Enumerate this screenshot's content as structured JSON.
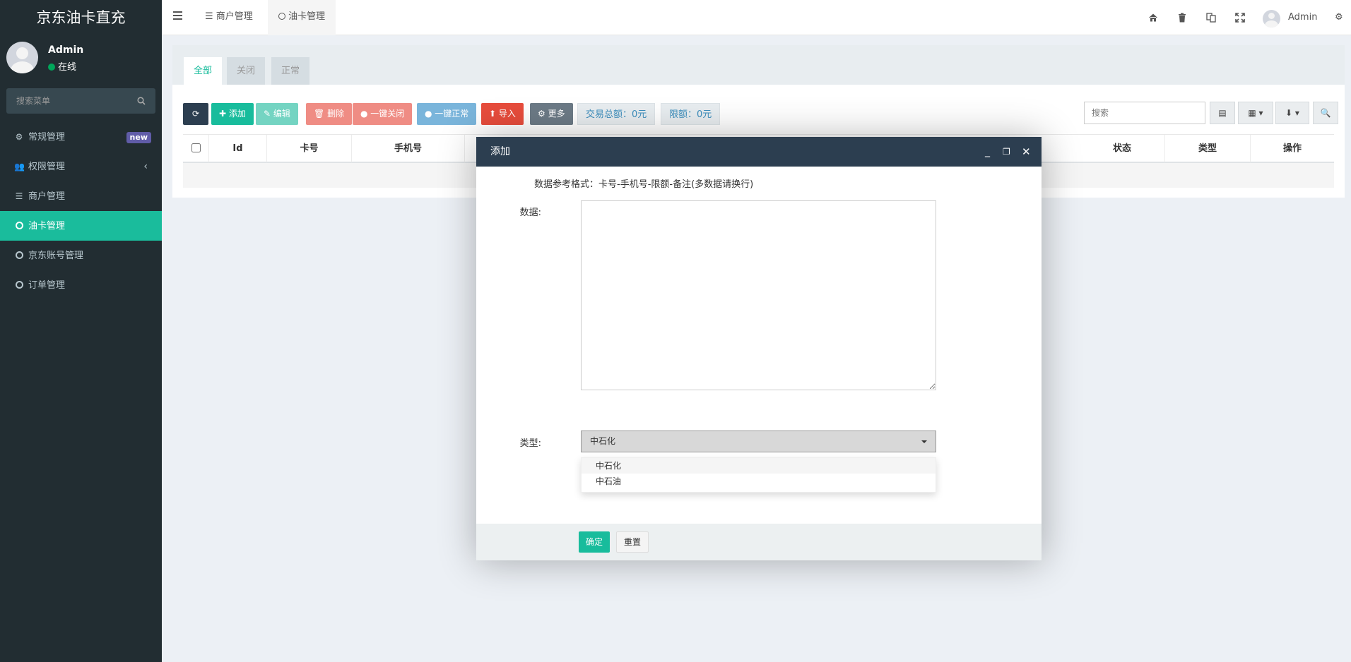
{
  "app": {
    "brand": "京东油卡直充"
  },
  "user": {
    "name": "Admin",
    "status": "在线"
  },
  "sidebar": {
    "search_placeholder": "搜索菜单",
    "items": [
      {
        "label": "常规管理",
        "icon": "cogs-icon",
        "badge": "new"
      },
      {
        "label": "权限管理",
        "icon": "group-icon",
        "chevron": "‹"
      },
      {
        "label": "商户管理",
        "icon": "list-icon"
      },
      {
        "label": "油卡管理",
        "icon": "circle-icon",
        "active": true
      },
      {
        "label": "京东账号管理",
        "icon": "circle-icon"
      },
      {
        "label": "订单管理",
        "icon": "circle-icon"
      }
    ]
  },
  "topbar": {
    "tabs": [
      {
        "label": "商户管理",
        "icon": "list-icon"
      },
      {
        "label": "油卡管理",
        "icon": "circle-icon",
        "active": true
      }
    ],
    "user_name": "Admin",
    "icons": [
      "home-icon",
      "trash-icon",
      "translate-icon",
      "fullscreen-icon",
      "gears-icon"
    ]
  },
  "panel": {
    "tabs": [
      "全部",
      "关闭",
      "正常"
    ],
    "toolbar": {
      "add": "添加",
      "edit": "编辑",
      "delete": "删除",
      "close_all": "一键关闭",
      "normal_all": "一键正常",
      "import": "导入",
      "more": "更多",
      "total_trade": "交易总额：0元",
      "limit": "限额：0元"
    },
    "search_placeholder": "搜索",
    "table_columns": [
      "Id",
      "卡号",
      "手机号",
      "状态",
      "类型",
      "操作"
    ]
  },
  "modal": {
    "title": "添加",
    "hint": "数据参考格式：卡号-手机号-限额-备注(多数据请换行)",
    "data_label": "数据:",
    "data_value": "",
    "type_label": "类型:",
    "type_selected": "中石化",
    "type_options": [
      "中石化",
      "中石油"
    ],
    "ok": "确定",
    "reset": "重置"
  },
  "colors": {
    "sidebar_bg": "#222d32",
    "accent": "#18bc9c",
    "modal_header": "#2c3e50",
    "danger": "#e74c3c",
    "info": "#3c8dbc",
    "badge": "#605ca8"
  }
}
